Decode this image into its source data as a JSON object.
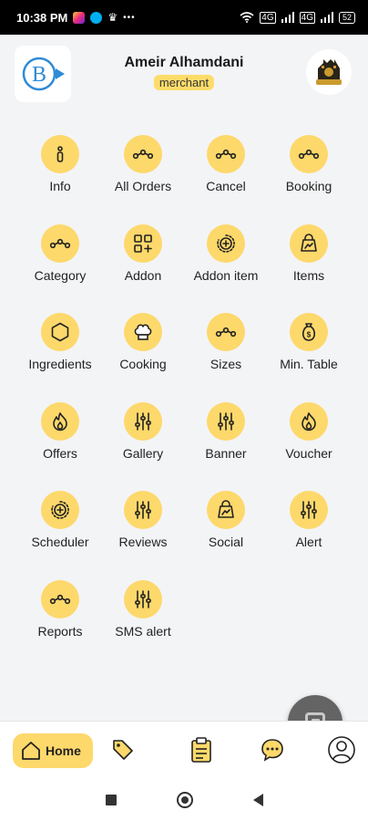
{
  "status_bar": {
    "time": "10:38 PM",
    "more": "•••",
    "battery": "52"
  },
  "header": {
    "logo_letter": "B",
    "name": "Ameir Alhamdani",
    "role": "merchant"
  },
  "tiles": [
    {
      "label": "Info",
      "icon": "info-icon"
    },
    {
      "label": "All Orders",
      "icon": "route-icon"
    },
    {
      "label": "Cancel",
      "icon": "route-icon"
    },
    {
      "label": "Booking",
      "icon": "route-icon"
    },
    {
      "label": "Category",
      "icon": "route-icon"
    },
    {
      "label": "Addon",
      "icon": "apps-add-icon"
    },
    {
      "label": "Addon item",
      "icon": "timer-add-icon"
    },
    {
      "label": "Items",
      "icon": "shop-bag-icon"
    },
    {
      "label": "Ingredients",
      "icon": "hexagon-icon"
    },
    {
      "label": "Cooking",
      "icon": "chef-hat-icon"
    },
    {
      "label": "Sizes",
      "icon": "route-icon"
    },
    {
      "label": "Min. Table",
      "icon": "money-bag-icon"
    },
    {
      "label": "Offers",
      "icon": "flame-icon"
    },
    {
      "label": "Gallery",
      "icon": "sliders-icon"
    },
    {
      "label": "Banner",
      "icon": "sliders-icon"
    },
    {
      "label": "Voucher",
      "icon": "flame-icon"
    },
    {
      "label": "Scheduler",
      "icon": "timer-add-icon"
    },
    {
      "label": "Reviews",
      "icon": "sliders-icon"
    },
    {
      "label": "Social",
      "icon": "shop-bag-icon"
    },
    {
      "label": "Alert",
      "icon": "sliders-icon"
    },
    {
      "label": "Reports",
      "icon": "route-icon"
    },
    {
      "label": "SMS alert",
      "icon": "sliders-icon"
    }
  ],
  "bottom_nav": {
    "home_label": "Home"
  },
  "colors": {
    "accent": "#fdd86b",
    "fab": "#646464",
    "background": "#f3f4f6"
  }
}
